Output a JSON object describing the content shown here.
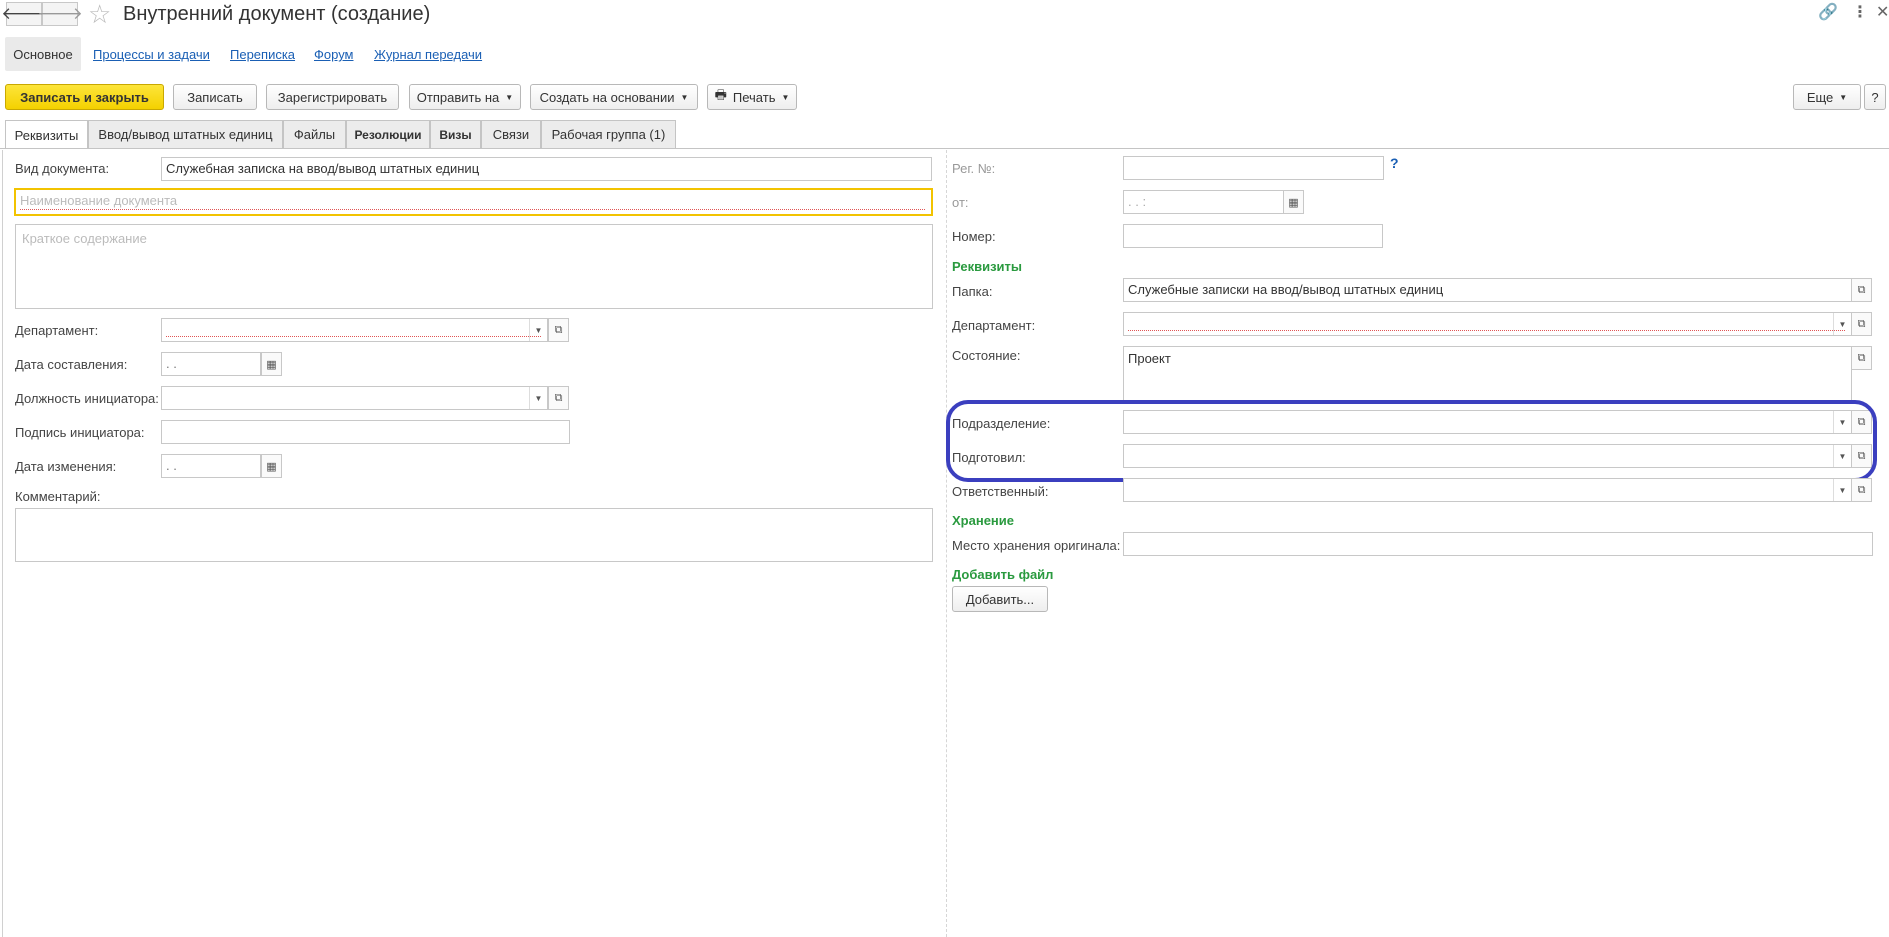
{
  "window": {
    "title": "Внутренний документ (создание)",
    "back_icon": "arrow-left-icon",
    "forward_icon": "arrow-right-icon"
  },
  "sections": {
    "active": "Основное",
    "links": [
      "Процессы и задачи",
      "Переписка",
      "Форум",
      "Журнал передачи"
    ]
  },
  "toolbar": {
    "save_close": "Записать и закрыть",
    "save": "Записать",
    "register": "Зарегистрировать",
    "send_to": "Отправить на",
    "create_based": "Создать на основании",
    "print": "Печать",
    "more": "Еще",
    "help": "?"
  },
  "tabs": [
    "Реквизиты",
    "Ввод/вывод штатных единиц",
    "Файлы",
    "Резолюции",
    "Визы",
    "Связи",
    "Рабочая группа (1)"
  ],
  "left": {
    "doc_type_label": "Вид документа:",
    "doc_type_value": "Служебная записка на ввод/вывод штатных единиц",
    "doc_name_placeholder": "Наименование документа",
    "summary_placeholder": "Краткое содержание",
    "department_label": "Департамент:",
    "date_created_label": "Дата составления:",
    "date_created_value": " .  .",
    "initiator_position_label": "Должность инициатора:",
    "initiator_signature_label": "Подпись инициатора:",
    "date_changed_label": "Дата изменения:",
    "date_changed_value": " .  .",
    "comment_label": "Комментарий:"
  },
  "right": {
    "reg_no_label": "Рег. №:",
    "reg_no_help": "?",
    "from_label": "от:",
    "from_value": " .  .        :",
    "number_label": "Номер:",
    "requisites_header": "Реквизиты",
    "folder_label": "Папка:",
    "folder_value": "Служебные записки на ввод/вывод штатных единиц",
    "department_label": "Департамент:",
    "state_label": "Состояние:",
    "state_value": "Проект",
    "subdivision_label": "Подразделение:",
    "prepared_label": "Подготовил:",
    "responsible_label": "Ответственный:",
    "storage_header": "Хранение",
    "original_location_label": "Место хранения оригинала:",
    "add_file_header": "Добавить файл",
    "add_button": "Добавить..."
  },
  "colors": {
    "primary_button": "#f4d100",
    "group_header": "#2a9a3f",
    "link": "#1a5fb4",
    "highlight": "#3b3fbf",
    "focus": "#f2c300"
  }
}
